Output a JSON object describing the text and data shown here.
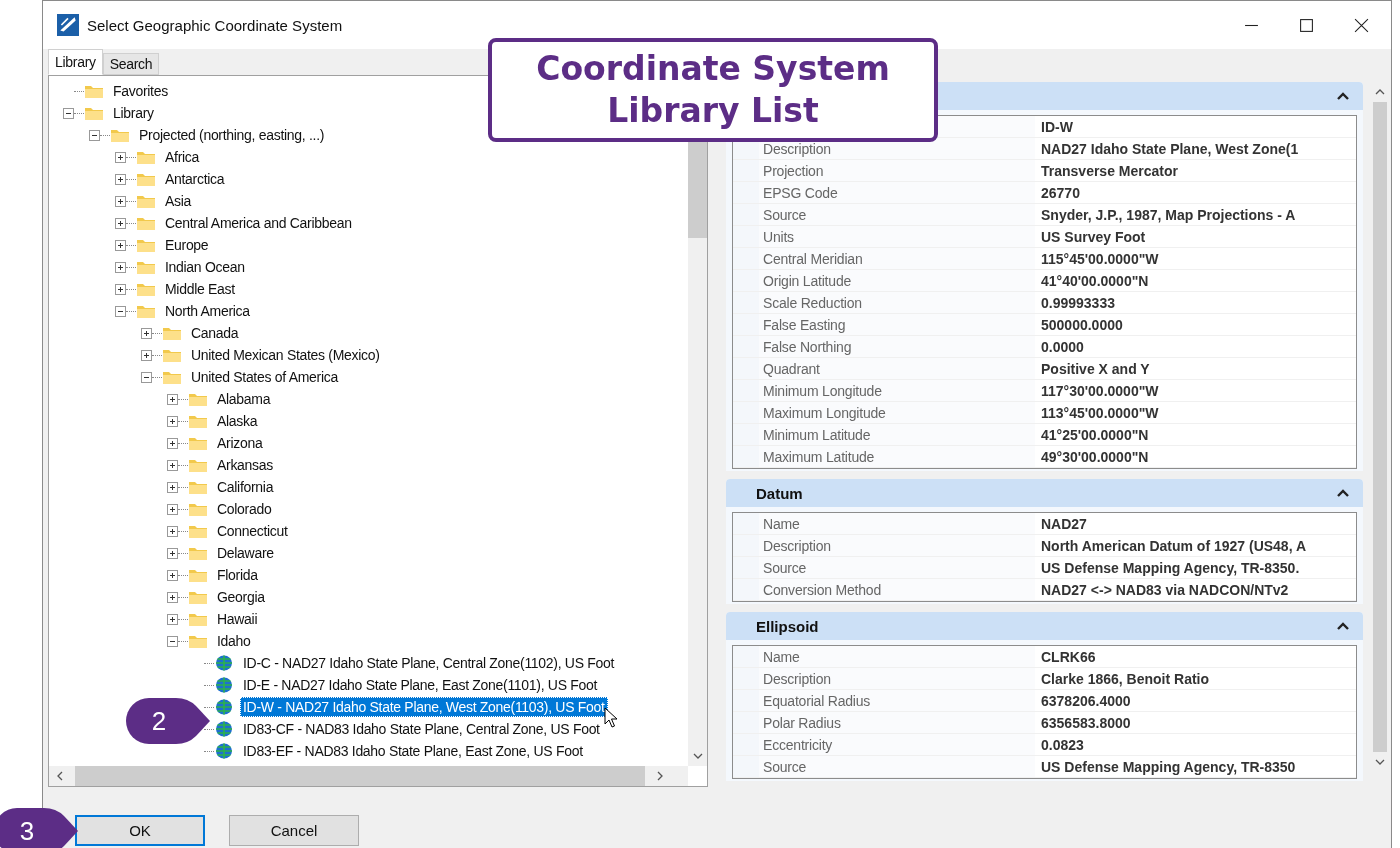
{
  "window": {
    "title": "Select Geographic Coordinate System"
  },
  "tabs": [
    {
      "label": "Library",
      "selected": true
    },
    {
      "label": "Search",
      "selected": false
    }
  ],
  "tree": [
    {
      "label": "Favorites",
      "kind": "folder"
    },
    {
      "label": "Library",
      "kind": "folder",
      "expanded": true,
      "children": [
        {
          "label": "Projected (northing, easting, ...)",
          "kind": "folder",
          "expanded": true,
          "children": [
            {
              "label": "Africa",
              "kind": "folder",
              "expanded": false
            },
            {
              "label": "Antarctica",
              "kind": "folder",
              "expanded": false
            },
            {
              "label": "Asia",
              "kind": "folder",
              "expanded": false
            },
            {
              "label": "Central America and Caribbean",
              "kind": "folder",
              "expanded": false
            },
            {
              "label": "Europe",
              "kind": "folder",
              "expanded": false
            },
            {
              "label": "Indian Ocean",
              "kind": "folder",
              "expanded": false
            },
            {
              "label": "Middle East",
              "kind": "folder",
              "expanded": false
            },
            {
              "label": "North America",
              "kind": "folder",
              "expanded": true,
              "children": [
                {
                  "label": "Canada",
                  "kind": "folder",
                  "expanded": false
                },
                {
                  "label": "United Mexican States (Mexico)",
                  "kind": "folder",
                  "expanded": false
                },
                {
                  "label": "United States of America",
                  "kind": "folder",
                  "expanded": true,
                  "children": [
                    {
                      "label": "Alabama",
                      "kind": "folder",
                      "expanded": false
                    },
                    {
                      "label": "Alaska",
                      "kind": "folder",
                      "expanded": false
                    },
                    {
                      "label": "Arizona",
                      "kind": "folder",
                      "expanded": false
                    },
                    {
                      "label": "Arkansas",
                      "kind": "folder",
                      "expanded": false
                    },
                    {
                      "label": "California",
                      "kind": "folder",
                      "expanded": false
                    },
                    {
                      "label": "Colorado",
                      "kind": "folder",
                      "expanded": false
                    },
                    {
                      "label": "Connecticut",
                      "kind": "folder",
                      "expanded": false
                    },
                    {
                      "label": "Delaware",
                      "kind": "folder",
                      "expanded": false
                    },
                    {
                      "label": "Florida",
                      "kind": "folder",
                      "expanded": false
                    },
                    {
                      "label": "Georgia",
                      "kind": "folder",
                      "expanded": false
                    },
                    {
                      "label": "Hawaii",
                      "kind": "folder",
                      "expanded": false
                    },
                    {
                      "label": "Idaho",
                      "kind": "folder",
                      "expanded": true,
                      "children": [
                        {
                          "label": "ID-C - NAD27 Idaho State Plane, Central Zone(1102), US Foot",
                          "kind": "system",
                          "selected": false
                        },
                        {
                          "label": "ID-E - NAD27 Idaho State Plane, East Zone(1101), US Foot",
                          "kind": "system",
                          "selected": false
                        },
                        {
                          "label": "ID-W - NAD27 Idaho State Plane, West Zone(1103), US Foot",
                          "kind": "system",
                          "selected": true
                        },
                        {
                          "label": "ID83-CF - NAD83 Idaho State Plane, Central Zone, US Foot",
                          "kind": "system",
                          "selected": false
                        },
                        {
                          "label": "ID83-EF - NAD83 Idaho State Plane, East Zone, US Foot",
                          "kind": "system",
                          "selected": false
                        }
                      ]
                    }
                  ]
                }
              ]
            }
          ]
        }
      ]
    }
  ],
  "sections": [
    {
      "rows": [
        {
          "value": "ID-W"
        },
        {
          "label": "Description",
          "value": "NAD27 Idaho State Plane, West Zone(1"
        },
        {
          "label": "Projection",
          "value": "Transverse Mercator"
        },
        {
          "label": "EPSG Code",
          "value": "26770"
        },
        {
          "label": "Source",
          "value": "Snyder, J.P., 1987, Map Projections - A"
        },
        {
          "label": "Units",
          "value": "US Survey Foot"
        },
        {
          "label": "Central Meridian",
          "value": "115°45'00.0000\"W"
        },
        {
          "label": "Origin Latitude",
          "value": "41°40'00.0000\"N"
        },
        {
          "label": "Scale Reduction",
          "value": "0.99993333"
        },
        {
          "label": "False Easting",
          "value": "500000.0000"
        },
        {
          "label": "False Northing",
          "value": "0.0000"
        },
        {
          "label": "Quadrant",
          "value": "Positive X and Y"
        },
        {
          "label": "Minimum Longitude",
          "value": "117°30'00.0000\"W"
        },
        {
          "label": "Maximum Longitude",
          "value": "113°45'00.0000\"W"
        },
        {
          "label": "Minimum Latitude",
          "value": "41°25'00.0000\"N"
        },
        {
          "label": "Maximum Latitude",
          "value": "49°30'00.0000\"N"
        }
      ]
    },
    {
      "title": "Datum",
      "rows": [
        {
          "label": "Name",
          "value": "NAD27"
        },
        {
          "label": "Description",
          "value": "North American Datum of 1927 (US48, A"
        },
        {
          "label": "Source",
          "value": "US Defense Mapping Agency, TR-8350."
        },
        {
          "label": "Conversion Method",
          "value": "NAD27 <-> NAD83 via NADCON/NTv2"
        }
      ]
    },
    {
      "title": "Ellipsoid",
      "rows": [
        {
          "label": "Name",
          "value": "CLRK66"
        },
        {
          "label": "Description",
          "value": "Clarke 1866, Benoit Ratio"
        },
        {
          "label": "Equatorial Radius",
          "value": "6378206.4000"
        },
        {
          "label": "Polar Radius",
          "value": "6356583.8000"
        },
        {
          "label": "Eccentricity",
          "value": "0.0823"
        },
        {
          "label": "Source",
          "value": "US Defense Mapping Agency, TR-8350"
        }
      ]
    }
  ],
  "buttons": [
    {
      "label": "OK",
      "kind": "default"
    },
    {
      "label": "Cancel",
      "kind": "normal"
    }
  ],
  "callout": {
    "lines": [
      "Coordinate System",
      "Library List"
    ]
  },
  "step_markers": [
    {
      "label": "2"
    },
    {
      "label": "3"
    }
  ]
}
